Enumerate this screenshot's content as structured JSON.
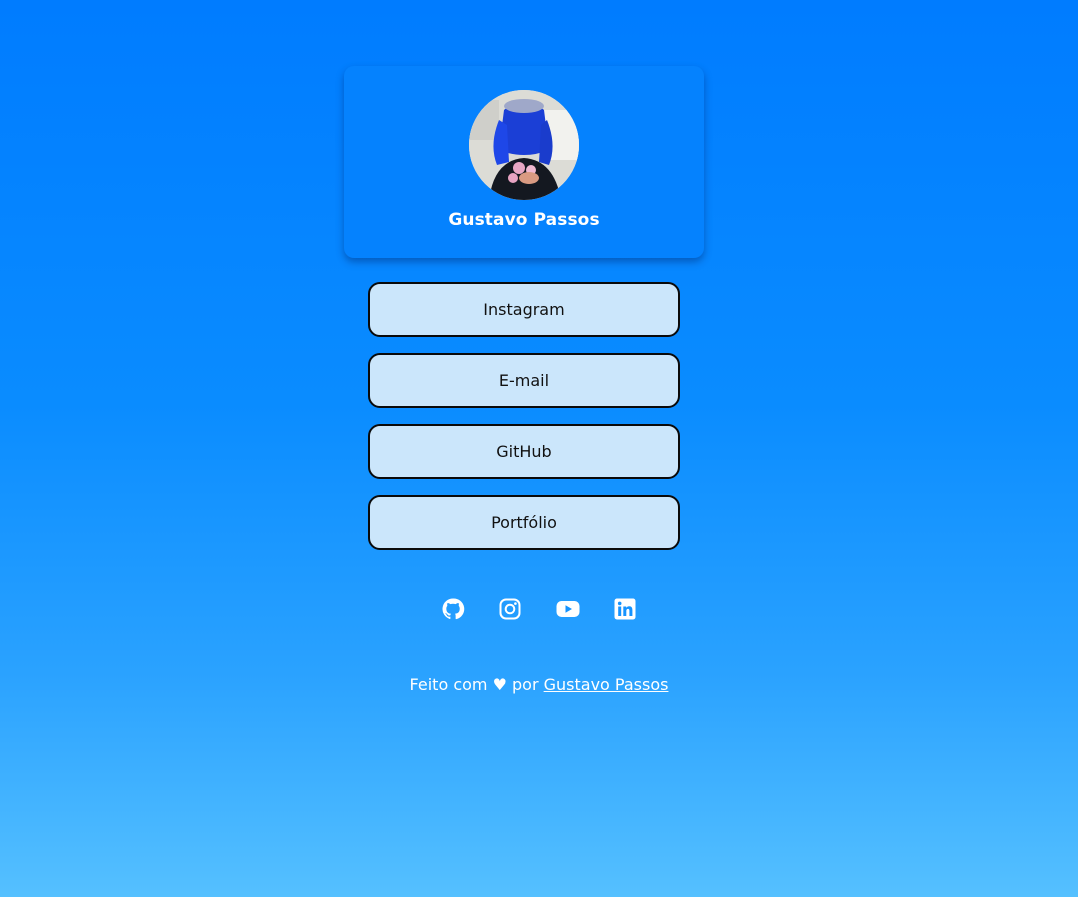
{
  "profile": {
    "name": "Gustavo Passos"
  },
  "links": [
    {
      "label": "Instagram"
    },
    {
      "label": "E-mail"
    },
    {
      "label": "GitHub"
    },
    {
      "label": "Portfólio"
    }
  ],
  "socials": [
    {
      "icon": "github-icon"
    },
    {
      "icon": "instagram-icon"
    },
    {
      "icon": "youtube-icon"
    },
    {
      "icon": "linkedin-icon"
    }
  ],
  "footer": {
    "prefix": "Feito com ♥ por",
    "author_link": "Gustavo Passos"
  },
  "colors": {
    "background_top": "#007cff",
    "background_bottom": "#55c0ff",
    "card": "#0582fe",
    "button": "#cbe6fb",
    "button_border": "#0a0a0a",
    "text_light": "#ffffff"
  }
}
